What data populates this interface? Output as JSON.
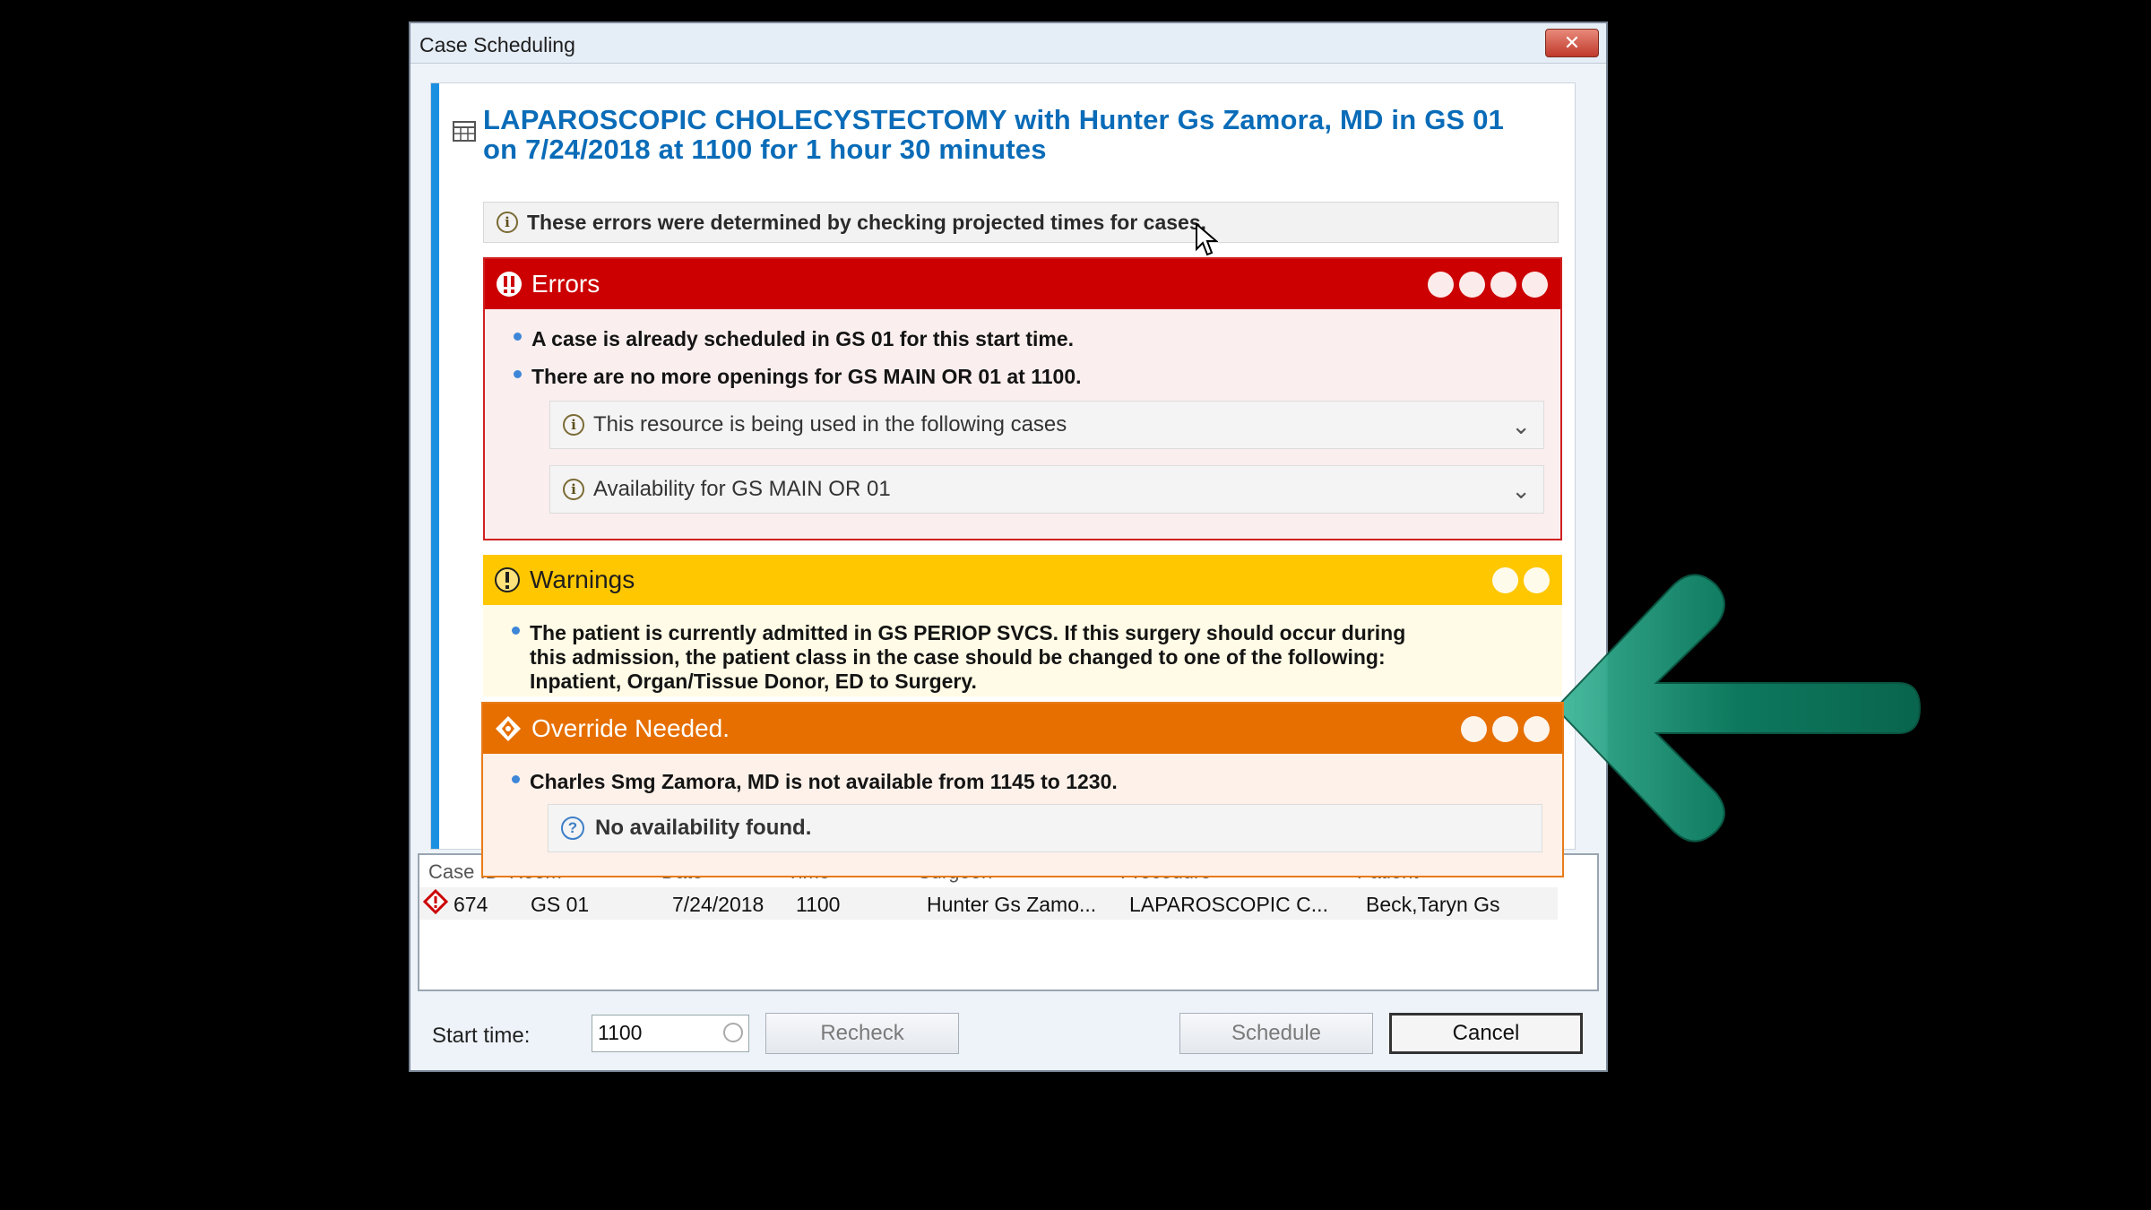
{
  "window": {
    "title": "Case Scheduling",
    "close_label": "✕"
  },
  "header": {
    "title": "LAPAROSCOPIC CHOLECYSTECTOMY with Hunter Gs Zamora, MD in GS 01 on 7/24/2018 at 1100 for 1 hour 30 minutes",
    "icon": "calendar-grid-icon"
  },
  "info": {
    "text": "These errors were determined by checking projected times for cases."
  },
  "errors": {
    "label": "Errors",
    "items": [
      "A case is already scheduled in GS 01 for this start time.",
      "There are no more openings for GS MAIN OR 01 at 1100."
    ],
    "subrows": [
      "This resource is being used in the following cases",
      "Availability for GS MAIN OR 01"
    ],
    "color": "#cc0000"
  },
  "warnings": {
    "label": "Warnings",
    "items": [
      "The patient is currently admitted in GS PERIOP SVCS. If this surgery should occur during this admission, the patient class in the case should be changed to one of the following: Inpatient, Organ/Tissue Donor, ED to Surgery."
    ],
    "color": "#ffc700"
  },
  "override": {
    "label": "Override Needed.",
    "items": [
      "Charles Smg Zamora, MD is not available from 1145 to 1230."
    ],
    "subrow": "No availability found.",
    "color": "#e66f00"
  },
  "grid": {
    "columns": [
      "Case ID",
      "Room",
      "Date",
      "Time",
      "Surgeon",
      "Procedure",
      "Patient"
    ],
    "rows": [
      [
        "674",
        "GS 01",
        "7/24/2018",
        "1100",
        "Hunter Gs Zamo...",
        "LAPAROSCOPIC C...",
        "Beck,Taryn Gs"
      ]
    ]
  },
  "footer": {
    "start_label": "Start time:",
    "start_value": "1100",
    "recheck": "Recheck",
    "schedule": "Schedule",
    "cancel": "Cancel"
  },
  "annotation": {
    "arrow_color": "#0b7a5c"
  }
}
